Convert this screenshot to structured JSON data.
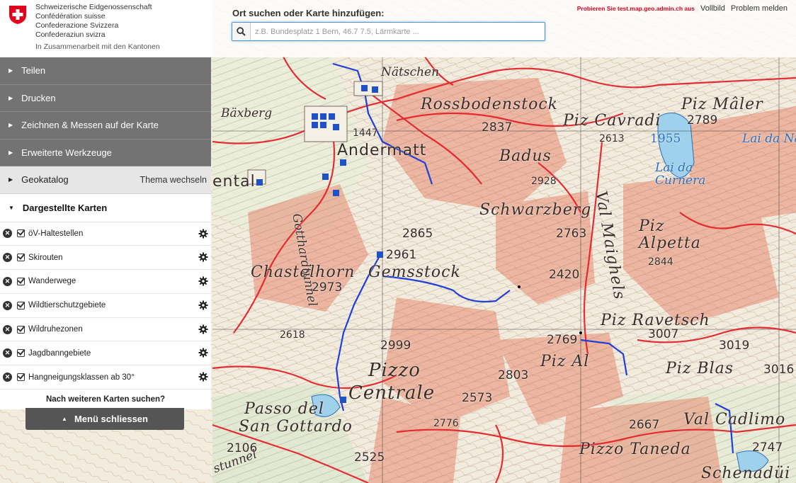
{
  "header": {
    "confederation": [
      "Schweizerische Eidgenossenschaft",
      "Confédération suisse",
      "Confederazione Svizzera",
      "Confederaziun svizra"
    ],
    "cooperation": "In Zusammenarbeit mit den Kantonen",
    "search_title": "Ort suchen oder Karte hinzufügen:",
    "search_placeholder": "z.B. Bundesplatz 1 Bern, 46.7 7.5, Lärmkarte ...",
    "test_link": "Probieren Sie test.map.geo.admin.ch aus",
    "fullscreen_link": "Vollbild",
    "report_link": "Problem melden"
  },
  "sidebar": {
    "share": "Teilen",
    "print": "Drucken",
    "draw": "Zeichnen & Messen auf der Karte",
    "tools": "Erweiterte Werkzeuge",
    "geocatalog": "Geokatalog",
    "theme_switch": "Thema wechseln",
    "displayed_maps": "Dargestellte Karten",
    "layers": [
      {
        "label": "öV-Haltestellen",
        "checked": true
      },
      {
        "label": "Skirouten",
        "checked": true
      },
      {
        "label": "Wanderwege",
        "checked": true
      },
      {
        "label": "Wildtierschutzgebiete",
        "checked": true
      },
      {
        "label": "Wildruhezonen",
        "checked": true
      },
      {
        "label": "Jagdbanngebiete",
        "checked": true
      },
      {
        "label": "Hangneigungsklassen ab 30°",
        "checked": true
      }
    ],
    "more_maps": "Nach weiteren Karten suchen?",
    "close_menu": "Menü schliessen"
  },
  "map": {
    "labels": {
      "natschen": "Nätschen",
      "rossbodenstock": "Rossbodenstock",
      "piz_maler": "Piz Mâler",
      "baxberg": "Bäxberg",
      "n1447": "1447",
      "andermatt": "Andermatt",
      "n2837": "2837",
      "badus": "Badus",
      "piz_cavradi": "Piz Cavradi",
      "n2613": "2613",
      "n1955": "1955",
      "n2789": "2789",
      "lai_da_curnera": "Lai da Curnera",
      "lai_da_na": "Lai da Na",
      "n2928": "2928",
      "schwarzberg": "Schwarzberg",
      "n2865": "2865",
      "n2763": "2763",
      "piz_alpetta": "Piz Alpetta",
      "n2961": "2961",
      "chastelhorn": "Chastelhorn",
      "gemsstock": "Gemsstock",
      "n2420": "2420",
      "n2844": "2844",
      "n2973": "2973",
      "n2618": "2618",
      "piz_ravetsch": "Piz Ravetsch",
      "n3007": "3007",
      "n2999": "2999",
      "n2769": "2769",
      "n3019": "3019",
      "pizzo": "Pizzo",
      "piz_al": "Piz Al",
      "piz_blas": "Piz Blas",
      "n3016": "3016",
      "centrale": "Centrale",
      "n2803": "2803",
      "passo_del": "Passo del",
      "san_gottardo": "San Gottardo",
      "n2573": "2573",
      "n2776": "2776",
      "n2667": "2667",
      "val_cadlimo": "Val Cadlimo",
      "n2106": "2106",
      "n2525": "2525",
      "pizzo_taneda": "Pizzo Taneda",
      "n2747": "2747",
      "schenadui": "Schenadüi",
      "gotthardtunnel": "Gotthardtunnel",
      "val_maighels": "Val Maighels",
      "ental": "ental",
      "stunnel": "stunnel"
    },
    "colors": {
      "hiking_trail": "#e3242b",
      "ski_route": "#1f3fd6",
      "steep_slope": "#e88a6f",
      "terrain": "#f2ecdf",
      "lake": "#9fd0ec"
    }
  }
}
